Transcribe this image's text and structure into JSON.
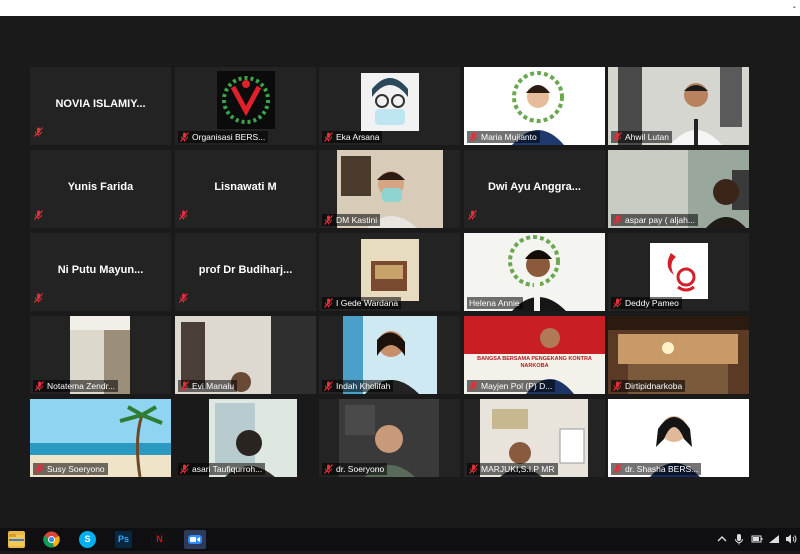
{
  "window": {
    "corner_mark": "-"
  },
  "participants": [
    {
      "label": "",
      "big_name": "NOVIA ISLAMIY...",
      "muted": true
    },
    {
      "label": "Organisasi BERS...",
      "big_name": "",
      "muted": true
    },
    {
      "label": "Eka Arsana",
      "big_name": "",
      "muted": true
    },
    {
      "label": "Maria Mujianto",
      "big_name": "",
      "muted": true
    },
    {
      "label": "Ahwil Lutan",
      "big_name": "",
      "muted": true
    },
    {
      "label": "",
      "big_name": "Yunis Farida",
      "muted": true
    },
    {
      "label": "",
      "big_name": "Lisnawati M",
      "muted": true
    },
    {
      "label": "DM Kastini",
      "big_name": "",
      "muted": true
    },
    {
      "label": "",
      "big_name": "Dwi Ayu Anggra...",
      "muted": true
    },
    {
      "label": "aspar pay ( aljah...",
      "big_name": "",
      "muted": true
    },
    {
      "label": "",
      "big_name": "Ni Putu Mayun...",
      "muted": true
    },
    {
      "label": "",
      "big_name": "prof Dr Budiharj...",
      "muted": true
    },
    {
      "label": "I Gede Wardana",
      "big_name": "",
      "muted": true
    },
    {
      "label": "Helena Annie",
      "big_name": "",
      "muted": false,
      "active_speaker": true
    },
    {
      "label": "Deddy Pameo",
      "big_name": "",
      "muted": true
    },
    {
      "label": "Notatema Zendr...",
      "big_name": "",
      "muted": true
    },
    {
      "label": "Evi Manalu",
      "big_name": "",
      "muted": true
    },
    {
      "label": "Indah Kholifah",
      "big_name": "",
      "muted": true
    },
    {
      "label": "Mayjen Pol (P) D...",
      "big_name": "",
      "muted": true
    },
    {
      "label": "Dirtipidnarkoba",
      "big_name": "",
      "muted": true
    },
    {
      "label": "Susy Soeryono",
      "big_name": "",
      "muted": true
    },
    {
      "label": "asari Taufiqurroh...",
      "big_name": "",
      "muted": true
    },
    {
      "label": "dr. Soeryono",
      "big_name": "",
      "muted": true
    },
    {
      "label": "MARJUKI,S.I.P MR",
      "big_name": "",
      "muted": true
    },
    {
      "label": "dr. Shasha BERS...",
      "big_name": "",
      "muted": true
    }
  ],
  "banner_text": "BANGSA BERSAMA PENGEKANG KONTRA NARKOBA",
  "taskbar": {
    "apps": [
      "file-explorer",
      "chrome",
      "skype",
      "photoshop",
      "netflix",
      "zoom"
    ],
    "ps_label": "Ps",
    "skype_label": "S",
    "netflix_label": "N"
  },
  "colors": {
    "active_outline": "#a6d22b",
    "muted_icon": "#e0303a",
    "background": "#1a1a1a"
  }
}
